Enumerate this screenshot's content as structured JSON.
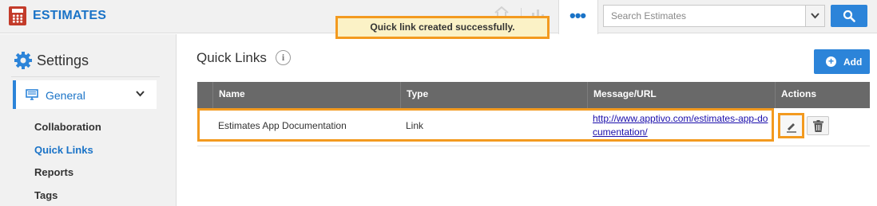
{
  "app": {
    "title": "ESTIMATES",
    "icon": "calculator-icon"
  },
  "header": {
    "home_icon": "home-icon",
    "chart_icon": "bar-chart-icon",
    "more_label": "•••",
    "search": {
      "placeholder": "Search Estimates",
      "value": ""
    },
    "search_button_icon": "search-icon"
  },
  "toast": {
    "message": "Quick link created successfully."
  },
  "sidebar": {
    "title": "Settings",
    "section": {
      "label": "General",
      "icon": "monitor-icon",
      "expanded": true
    },
    "items": [
      {
        "label": "Collaboration",
        "active": false
      },
      {
        "label": "Quick Links",
        "active": true
      },
      {
        "label": "Reports",
        "active": false
      },
      {
        "label": "Tags",
        "active": false
      }
    ]
  },
  "main": {
    "title": "Quick Links",
    "info_glyph": "i",
    "add_button": {
      "label": "Add"
    },
    "table": {
      "columns": [
        "Name",
        "Type",
        "Message/URL",
        "Actions"
      ],
      "rows": [
        {
          "name": "Estimates App Documentation",
          "type": "Link",
          "url": "http://www.apptivo.com/estimates-app-documentation/",
          "url_line1": "http://www.apptivo.com/estimates-app-do",
          "url_line2": "cumentation/"
        }
      ]
    }
  },
  "colors": {
    "brand_blue": "#1a73c7",
    "button_blue": "#2c84d9",
    "highlight_orange": "#f39a1f",
    "toast_bg": "#fbf2c6",
    "table_header": "#696969"
  }
}
